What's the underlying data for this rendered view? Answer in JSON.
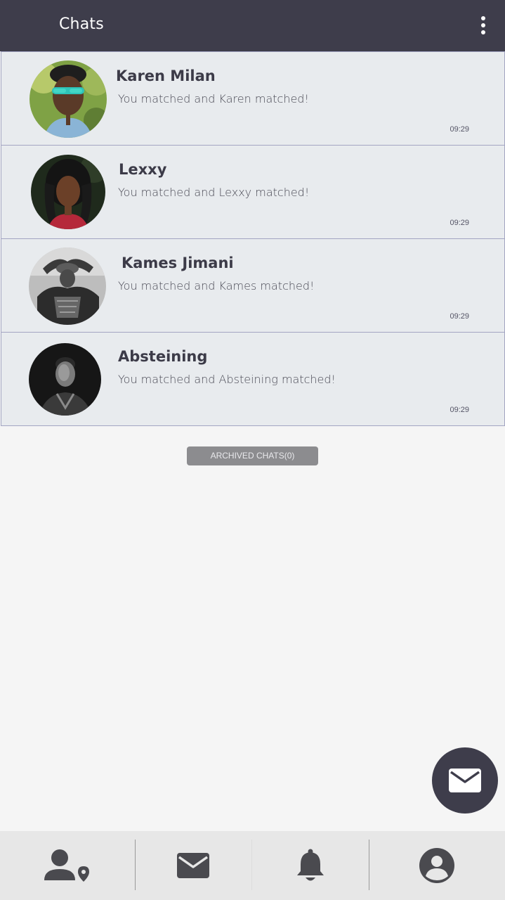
{
  "header": {
    "title": "Chats",
    "background": "#3e3d4b",
    "overflow_icon": "more-vert-icon"
  },
  "chats": [
    {
      "name": "Karen Milan",
      "message": "You matched and Karen matched!",
      "time": "09:29"
    },
    {
      "name": "Lexxy",
      "message": "You matched and Lexxy matched!",
      "time": "09:29"
    },
    {
      "name": "Kames Jimani",
      "message": "You matched and Kames matched!",
      "time": "09:29"
    },
    {
      "name": "Absteining",
      "message": "You matched and Absteining matched!",
      "time": "09:29"
    }
  ],
  "archived": {
    "label": "ARCHIVED CHATS(0)"
  },
  "fab": {
    "icon": "mail-icon",
    "color": "#3e3d4b"
  },
  "bottom_nav": {
    "items": [
      {
        "icon": "nearby-people-icon"
      },
      {
        "icon": "mail-icon"
      },
      {
        "icon": "bell-icon"
      },
      {
        "icon": "account-icon"
      }
    ],
    "icon_color": "#4a4a4f"
  },
  "colors": {
    "row_background": "#e8ebee",
    "row_border": "#a3a5c2",
    "page_background": "#f5f5f5"
  }
}
